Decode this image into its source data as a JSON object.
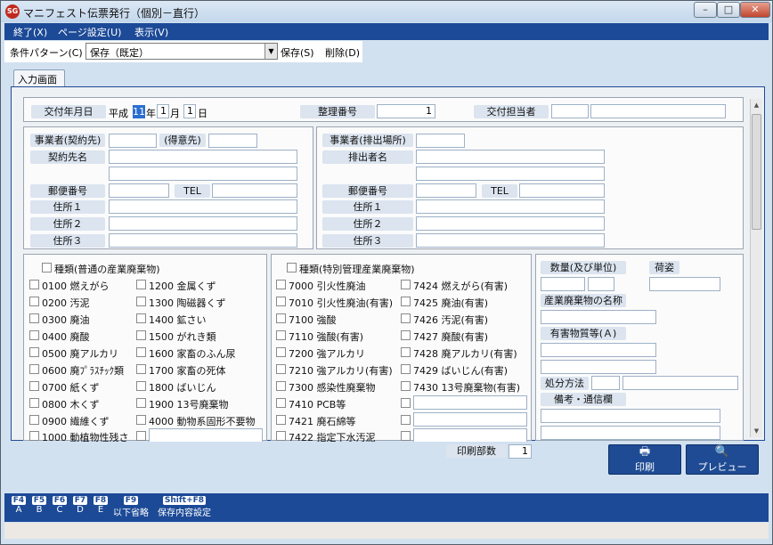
{
  "window": {
    "title": "マニフェスト伝票発行（個別－直行）",
    "app_icon": "manifest-app-icon",
    "controls": [
      "minimize",
      "maximize",
      "close"
    ]
  },
  "menu": [
    {
      "label": "終了(X)"
    },
    {
      "label": "ページ設定(U)"
    },
    {
      "label": "表示(V)"
    }
  ],
  "condition": {
    "label": "条件パターン(C)",
    "value": "保存（既定）",
    "save_label": "保存(S)",
    "delete_label": "削除(D)"
  },
  "tabs": [
    {
      "label": "入力画面"
    }
  ],
  "header": {
    "issue_date_label": "交付年月日",
    "era": "平成",
    "year": "11",
    "year_suffix": "年",
    "month": "1",
    "month_suffix": "月",
    "day": "1",
    "day_suffix": "日",
    "ref_label": "整理番号",
    "ref_value": "1",
    "staff_label": "交付担当者",
    "staff_code": "",
    "staff_name": ""
  },
  "left_block": {
    "business_label": "事業者(契約先)",
    "customer_label": "(得意先)",
    "contract_name_label": "契約先名",
    "zip_label": "郵便番号",
    "tel_label": "TEL",
    "addr1_label": "住所１",
    "addr2_label": "住所２",
    "addr3_label": "住所３"
  },
  "right_block": {
    "business_label": "事業者(排出場所)",
    "emitter_label": "排出者名",
    "zip_label": "郵便番号",
    "tel_label": "TEL",
    "addr1_label": "住所１",
    "addr2_label": "住所２",
    "addr3_label": "住所３"
  },
  "normal_waste": {
    "header": "種類(普通の産業廃棄物)",
    "col1": [
      "0100 燃えがら",
      "0200 汚泥",
      "0300 廃油",
      "0400 廃酸",
      "0500 廃アルカリ",
      "0600 廃ﾌﾟﾗｽﾁｯｸ類",
      "0700 紙くず",
      "0800 木くず",
      "0900 繊維くず",
      "1000 動植物性残さ"
    ],
    "col2": [
      "1200 金属くず",
      "1300 陶磁器くず",
      "1400 鉱さい",
      "1500 がれき類",
      "1600 家畜のふん尿",
      "1700 家畜の死体",
      "1800 ばいじん",
      "1900 13号廃棄物",
      "4000 動物系固形不要物",
      ""
    ]
  },
  "special_waste": {
    "header": "種類(特別管理産業廃棄物)",
    "col1": [
      "7000 引火性廃油",
      "7010 引火性廃油(有害)",
      "7100 強酸",
      "7110 強酸(有害)",
      "7200 強アルカリ",
      "7210 強アルカリ(有害)",
      "7300 感染性廃棄物",
      "7410 PCB等",
      "7421 廃石綿等",
      "7422 指定下水汚泥"
    ],
    "col2": [
      "7424 燃えがら(有害)",
      "7425 廃油(有害)",
      "7426 汚泥(有害)",
      "7427 廃酸(有害)",
      "7428 廃アルカリ(有害)",
      "7429 ばいじん(有害)",
      "7430 13号廃棄物(有害)",
      "",
      "",
      ""
    ]
  },
  "side": {
    "qty_label": "数量(及び単位)",
    "pack_label": "荷姿",
    "waste_name_label": "産業廃棄物の名称",
    "hazard_label": "有害物質等(Ａ)",
    "disposal_label": "処分方法",
    "remarks_label": "備考・通信欄"
  },
  "print": {
    "copies_label": "印刷部数",
    "copies_value": "1",
    "print_label": "印刷",
    "preview_label": "プレビュー",
    "print_icon": "printer-icon",
    "preview_icon": "preview-icon"
  },
  "fkeys": [
    {
      "key": "F4",
      "label": "A"
    },
    {
      "key": "F5",
      "label": "B"
    },
    {
      "key": "F6",
      "label": "C"
    },
    {
      "key": "F7",
      "label": "D"
    },
    {
      "key": "F8",
      "label": "E"
    },
    {
      "key": "F9",
      "label": "以下省略"
    },
    {
      "key": "Shift+F8",
      "label": "保存内容設定"
    }
  ]
}
